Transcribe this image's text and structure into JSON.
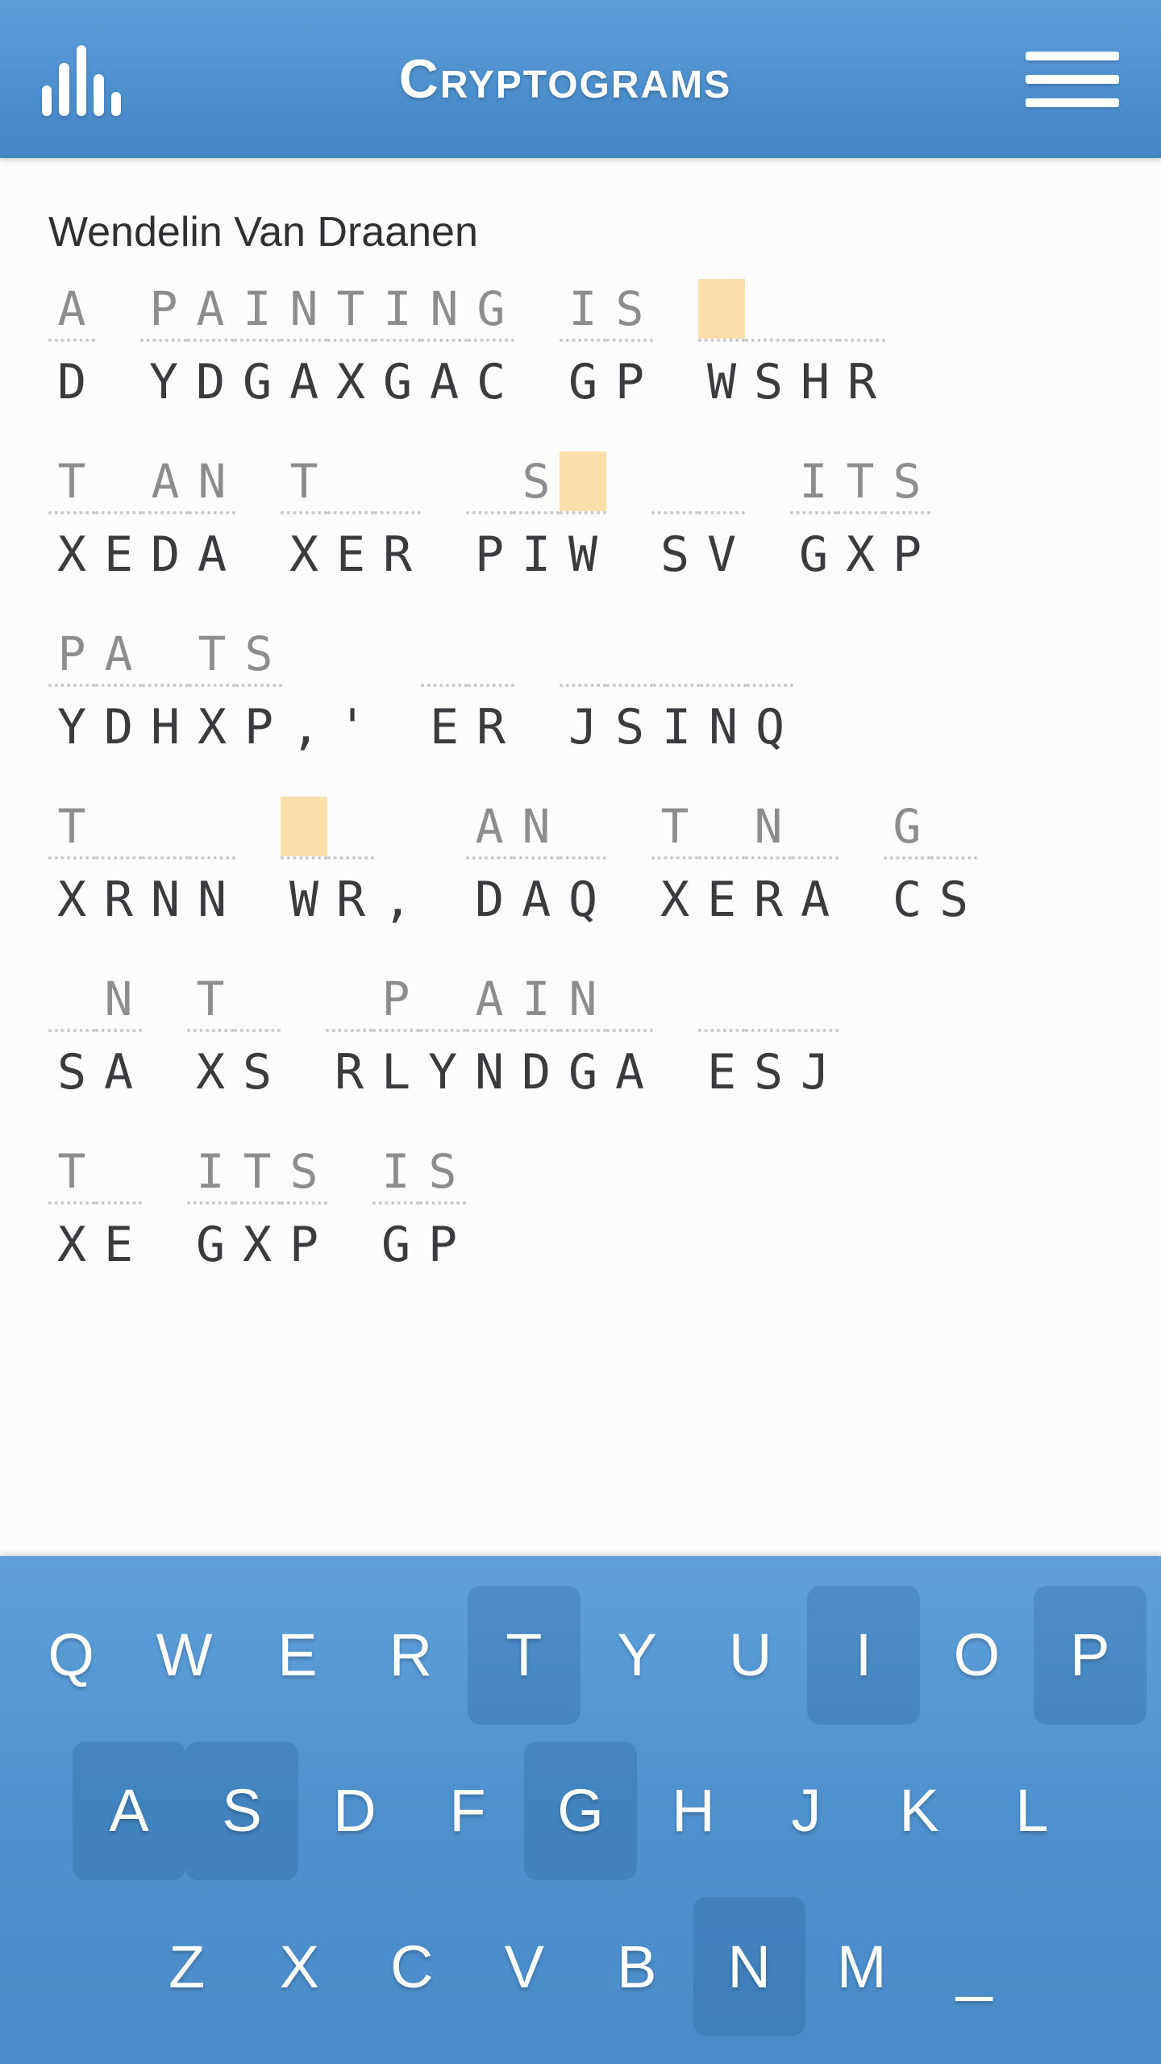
{
  "header": {
    "title": "Cryptograms",
    "logo_icon": "bar-chart-icon",
    "menu_icon": "hamburger-menu-icon"
  },
  "puzzle": {
    "author": "Wendelin Van Draanen",
    "highlight_color": "#fcdfab",
    "lines": [
      {
        "words": [
          {
            "cipher": "D",
            "guess": "A",
            "highlight": []
          },
          {
            "cipher": "YDGAXGAC",
            "guess": "PAINTING",
            "highlight": []
          },
          {
            "cipher": "GP",
            "guess": "IS",
            "highlight": []
          },
          {
            "cipher": "WSHR",
            "guess": "    ",
            "highlight": [
              0
            ]
          }
        ]
      },
      {
        "words": [
          {
            "cipher": "XEDA",
            "guess": "T AN",
            "highlight": []
          },
          {
            "cipher": "XER",
            "guess": "T  ",
            "highlight": []
          },
          {
            "cipher": "PIW",
            "guess": " S ",
            "highlight": [
              2
            ]
          },
          {
            "cipher": "SV",
            "guess": "  ",
            "highlight": []
          },
          {
            "cipher": "GXP",
            "guess": "ITS",
            "highlight": []
          }
        ]
      },
      {
        "words": [
          {
            "cipher": "YDHXP,'",
            "guess": "PA TS,'",
            "highlight": []
          },
          {
            "cipher": "ER",
            "guess": "  ",
            "highlight": []
          },
          {
            "cipher": "JSINQ",
            "guess": "     ",
            "highlight": []
          }
        ]
      },
      {
        "words": [
          {
            "cipher": "XRNN",
            "guess": "T   ",
            "highlight": []
          },
          {
            "cipher": "WR,",
            "guess": "  ,",
            "highlight": [
              0
            ]
          },
          {
            "cipher": "DAQ",
            "guess": "AN ",
            "highlight": []
          },
          {
            "cipher": "XERA",
            "guess": "T N ",
            "highlight": []
          },
          {
            "cipher": "CS",
            "guess": "G ",
            "highlight": []
          }
        ]
      },
      {
        "words": [
          {
            "cipher": "SA",
            "guess": " N",
            "highlight": []
          },
          {
            "cipher": "XS",
            "guess": "T ",
            "highlight": []
          },
          {
            "cipher": "RLYNDGA",
            "guess": " P AIN ",
            "highlight": []
          },
          {
            "cipher": "ESJ",
            "guess": "   ",
            "highlight": []
          }
        ]
      },
      {
        "words": [
          {
            "cipher": "XE",
            "guess": "T ",
            "highlight": []
          },
          {
            "cipher": "",
            "guess": "",
            "highlight": []
          },
          {
            "cipher": "GXP",
            "guess": "ITS",
            "highlight": []
          },
          {
            "cipher": "",
            "guess": "",
            "highlight": []
          },
          {
            "cipher": "GP",
            "guess": "IS",
            "highlight": []
          }
        ]
      }
    ]
  },
  "keyboard": {
    "rows": [
      [
        {
          "label": "Q",
          "used": false
        },
        {
          "label": "W",
          "used": false
        },
        {
          "label": "E",
          "used": false
        },
        {
          "label": "R",
          "used": false
        },
        {
          "label": "T",
          "used": true
        },
        {
          "label": "Y",
          "used": false
        },
        {
          "label": "U",
          "used": false
        },
        {
          "label": "I",
          "used": true
        },
        {
          "label": "O",
          "used": false
        },
        {
          "label": "P",
          "used": true
        }
      ],
      [
        {
          "label": "A",
          "used": true
        },
        {
          "label": "S",
          "used": true
        },
        {
          "label": "D",
          "used": false
        },
        {
          "label": "F",
          "used": false
        },
        {
          "label": "G",
          "used": true
        },
        {
          "label": "H",
          "used": false
        },
        {
          "label": "J",
          "used": false
        },
        {
          "label": "K",
          "used": false
        },
        {
          "label": "L",
          "used": false
        }
      ],
      [
        {
          "label": "Z",
          "used": false
        },
        {
          "label": "X",
          "used": false
        },
        {
          "label": "C",
          "used": false
        },
        {
          "label": "V",
          "used": false
        },
        {
          "label": "B",
          "used": false
        },
        {
          "label": "N",
          "used": true
        },
        {
          "label": "M",
          "used": false
        },
        {
          "label": "_",
          "used": false
        }
      ]
    ]
  }
}
